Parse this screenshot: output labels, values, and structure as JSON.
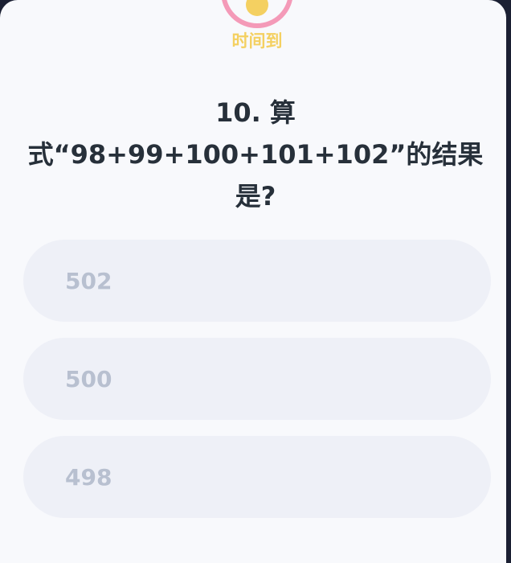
{
  "timer": {
    "label": "时间到",
    "ring_color": "#f49ab8",
    "dot_color": "#f4d061"
  },
  "question": {
    "text": "10. 算式“98+99+100+101+102”的结果是?"
  },
  "options": [
    {
      "label": "502"
    },
    {
      "label": "500"
    },
    {
      "label": "498"
    }
  ]
}
